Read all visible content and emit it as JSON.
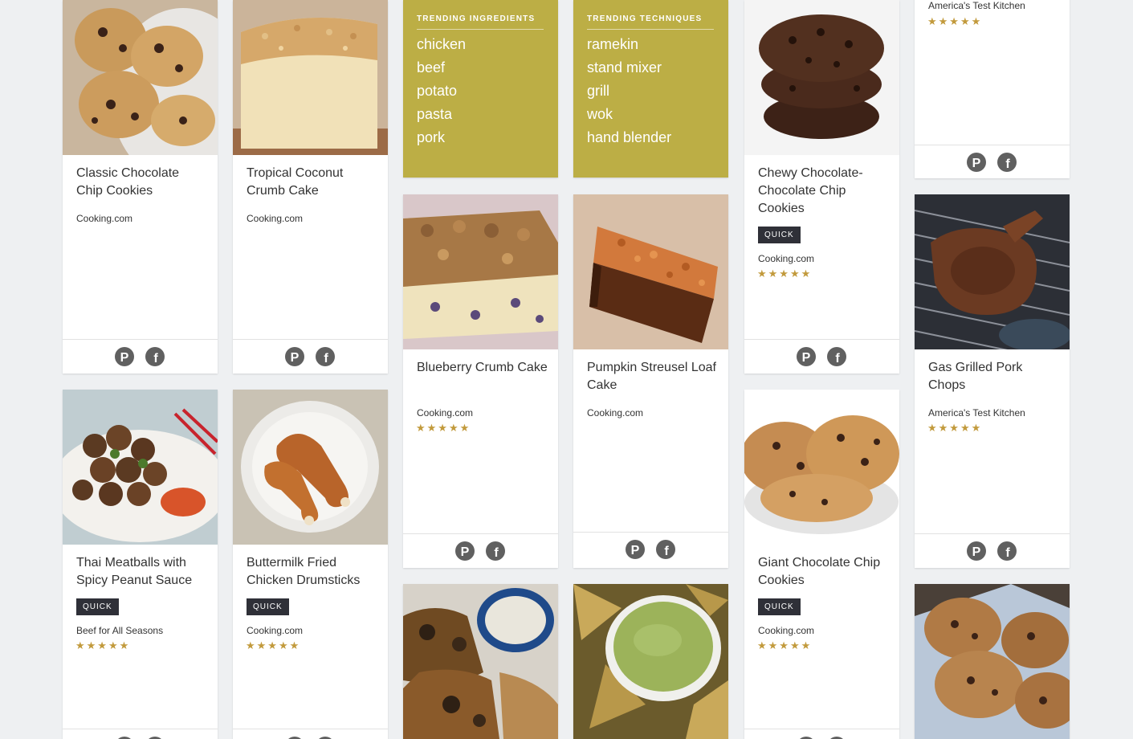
{
  "quick_label": "QUICK",
  "stars_text": "★★★★★",
  "cards": {
    "c1": {
      "title": "Classic Chocolate Chip Cookies",
      "source": "Cooking.com"
    },
    "c2": {
      "title": "Tropical Coconut Crumb Cake",
      "source": "Cooking.com"
    },
    "c3": {
      "title": "Blueberry Crumb Cake",
      "source": "Cooking.com",
      "rating": 5
    },
    "c4": {
      "title": "Pumpkin Streusel Loaf Cake",
      "source": "Cooking.com"
    },
    "c5": {
      "title": "Chewy Chocolate-Chocolate Chip Cookies",
      "source": "Cooking.com",
      "rating": 5
    },
    "c6": {
      "source": "America's Test Kitchen",
      "rating": 5
    },
    "c7": {
      "title": "Gas Grilled Pork Chops",
      "source": "America's Test Kitchen",
      "rating": 5
    },
    "c8": {
      "title": "Thai Meatballs with Spicy Peanut Sauce",
      "source": "Beef for All Seasons",
      "rating": 5
    },
    "c9": {
      "title": "Buttermilk Fried Chicken Drumsticks",
      "source": "Cooking.com",
      "rating": 5
    },
    "c10": {
      "title": "Giant Chocolate Chip Cookies",
      "source": "Cooking.com",
      "rating": 5
    }
  },
  "trending_ingredients": {
    "heading": "TRENDING INGREDIENTS",
    "items": [
      "chicken",
      "beef",
      "potato",
      "pasta",
      "pork"
    ]
  },
  "trending_techniques": {
    "heading": "TRENDING TECHNIQUES",
    "items": [
      "ramekin",
      "stand mixer",
      "grill",
      "wok",
      "hand blender"
    ]
  },
  "colors": {
    "background": "#eef0f2",
    "trending_panel": "#bcae45",
    "badge": "#2f3038",
    "stars": "#c29a3c",
    "share_icon": "#606060"
  },
  "icons": [
    "pinterest-icon",
    "facebook-icon"
  ]
}
